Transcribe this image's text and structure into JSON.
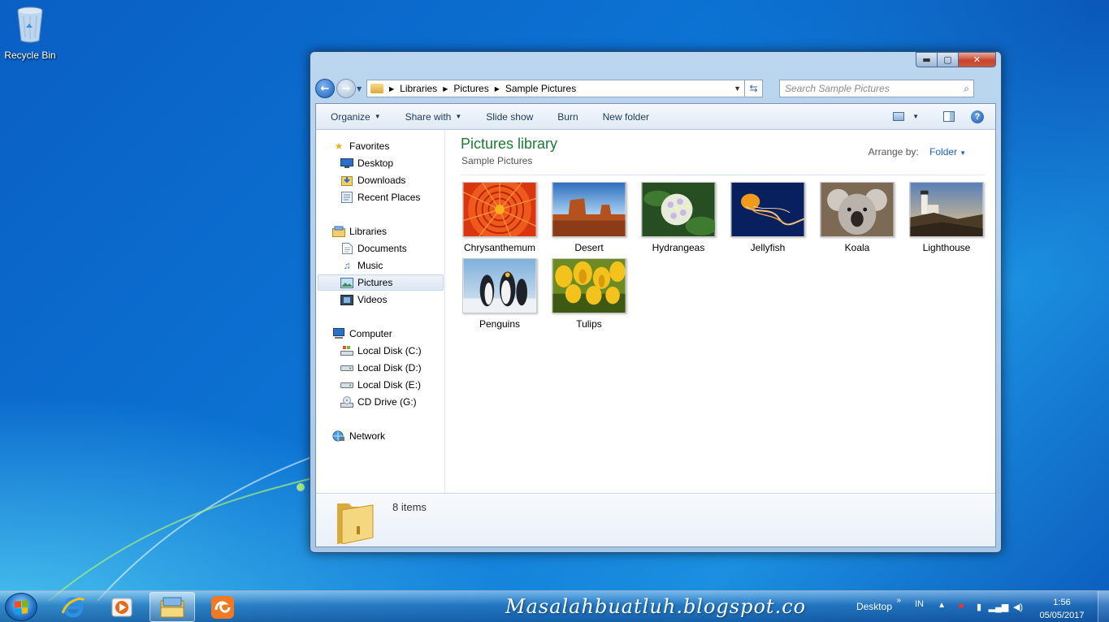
{
  "desktop": {
    "recycle_bin_label": "Recycle Bin"
  },
  "window": {
    "controls": {
      "minimize": "▬",
      "maximize": "▢",
      "close": "✕"
    },
    "breadcrumb": [
      "Libraries",
      "Pictures",
      "Sample Pictures"
    ],
    "search_placeholder": "Search Sample Pictures",
    "toolbar": {
      "organize": "Organize",
      "share_with": "Share with",
      "slide_show": "Slide show",
      "burn": "Burn",
      "new_folder": "New folder",
      "help": "?"
    },
    "nav": {
      "favorites": {
        "label": "Favorites",
        "items": [
          "Desktop",
          "Downloads",
          "Recent Places"
        ]
      },
      "libraries": {
        "label": "Libraries",
        "items": [
          "Documents",
          "Music",
          "Pictures",
          "Videos"
        ],
        "selected": "Pictures"
      },
      "computer": {
        "label": "Computer",
        "items": [
          "Local Disk (C:)",
          "Local Disk (D:)",
          "Local Disk (E:)",
          "CD Drive (G:)"
        ]
      },
      "network": {
        "label": "Network"
      }
    },
    "main": {
      "title": "Pictures library",
      "subtitle": "Sample Pictures",
      "arrange_label": "Arrange by:",
      "arrange_value": "Folder",
      "files": [
        "Chrysanthemum",
        "Desert",
        "Hydrangeas",
        "Jellyfish",
        "Koala",
        "Lighthouse",
        "Penguins",
        "Tulips"
      ]
    },
    "details": {
      "item_count": "8 items"
    }
  },
  "taskbar": {
    "watermark": "Masalahbuatluh.blogspot.co",
    "tray": {
      "desktop_label": "Desktop",
      "chevron": "»",
      "language": "IN",
      "time": "1:56",
      "date": "05/05/2017"
    }
  },
  "colors": {
    "library_title": "#1e7a35",
    "link_blue": "#1e62c4",
    "toolbar_text": "#1e395b"
  }
}
